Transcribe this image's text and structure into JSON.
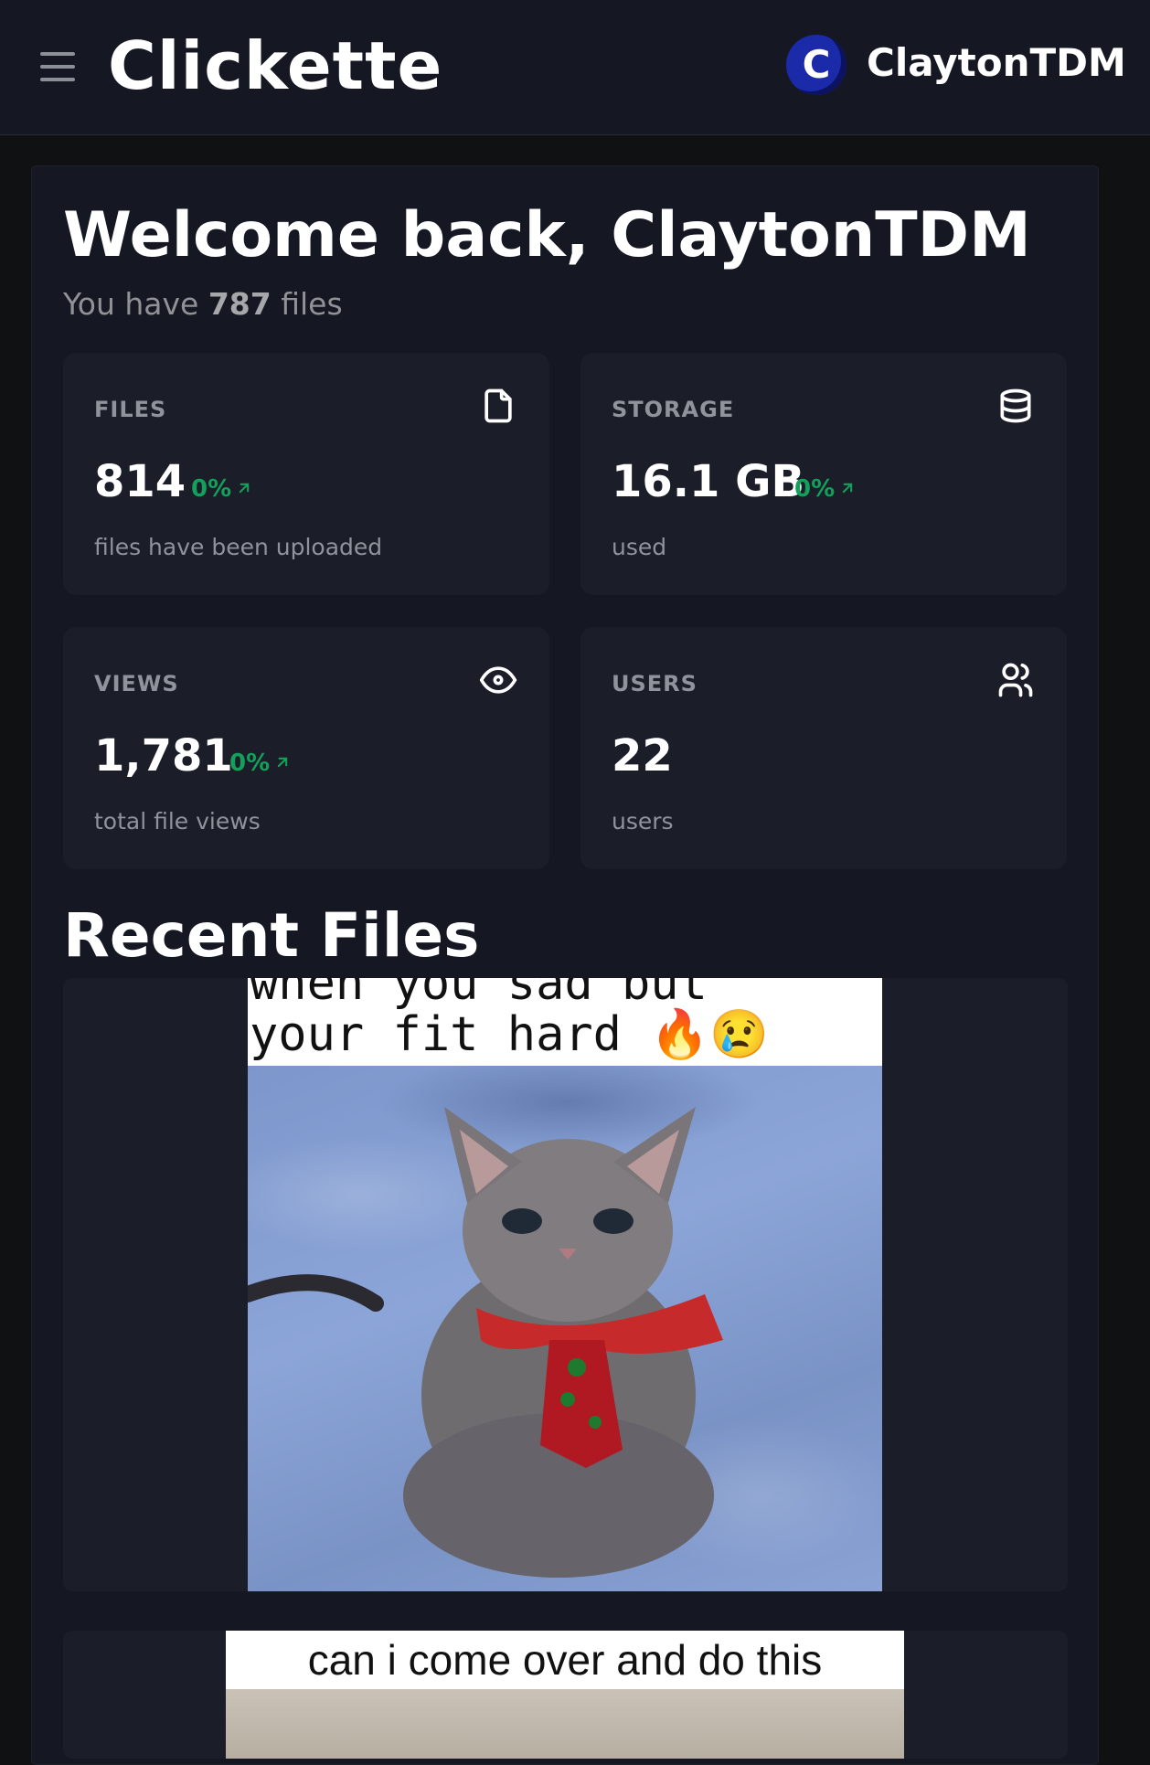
{
  "header": {
    "brand": "Clickette",
    "avatar_letter": "C",
    "username": "ClaytonTDM"
  },
  "welcome": {
    "title": "Welcome back, ClaytonTDM",
    "subtitle_prefix": "You have ",
    "file_count": "787",
    "subtitle_suffix": " files"
  },
  "stats": [
    {
      "label": "FILES",
      "value": "814",
      "diff": "0%",
      "desc": "files have been uploaded",
      "icon": "file-icon"
    },
    {
      "label": "STORAGE",
      "value": "16.1 GB",
      "diff": "0%",
      "desc": "used",
      "icon": "database-icon"
    },
    {
      "label": "VIEWS",
      "value": "1,781",
      "diff": "0%",
      "desc": "total file views",
      "icon": "eye-icon"
    },
    {
      "label": "USERS",
      "value": "22",
      "desc": "users",
      "icon": "users-icon"
    }
  ],
  "recent": {
    "title": "Recent Files",
    "files": [
      {
        "caption_line1": "when you sad but",
        "caption_line2": "your fit hard 🔥😢"
      },
      {
        "caption": "can i come over and do this"
      }
    ]
  },
  "colors": {
    "background": "#101113",
    "card": "#1b1d29",
    "accent_green": "#12a05a",
    "avatar": "#1b2aa8"
  }
}
